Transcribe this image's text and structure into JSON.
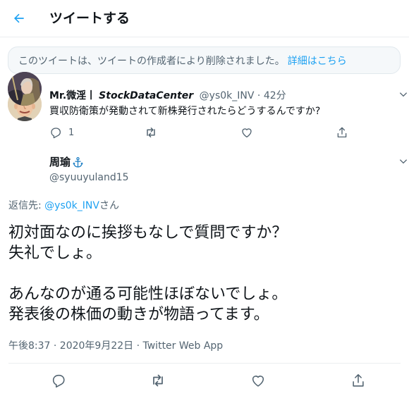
{
  "header": {
    "title": "ツイートする"
  },
  "deleted_notice": {
    "text": "このツイートは、ツイートの作成者により削除されました。",
    "link": "詳細はこちら"
  },
  "parent_tweet": {
    "display_name": "Mr.微淫丨",
    "display_name_italic": "StockDataCenter",
    "handle": "@ys0k_INV",
    "separator": "·",
    "time": "42分",
    "text": "買収防衛策が発動されて新株発行されたらどうするんですか?",
    "reply_count": "1"
  },
  "main_tweet": {
    "display_name": "周瑜",
    "badge_icon": "anchor-icon",
    "handle": "@syuuyuland15",
    "reply_prefix": "返信先: ",
    "reply_handle": "@ys0k_INV",
    "reply_suffix": "さん",
    "lines": [
      "初対面なのに挨拶もなしで質問ですか？",
      "失礼でしょ。",
      "",
      "あんなのが通る可能性ほぼないでしょ。",
      "発表後の株価の動きが物語ってます。"
    ],
    "timestamp": "午後8:37 · 2020年9月22日 · ",
    "source": "Twitter Web App"
  },
  "colors": {
    "accent": "#1da1f2",
    "muted": "#536471",
    "text": "#0f1419"
  }
}
